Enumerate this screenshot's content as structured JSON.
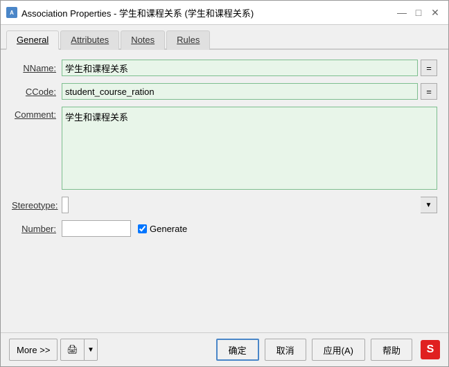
{
  "window": {
    "title": "Association Properties - 学生和课程关系 (学生和课程关系)",
    "icon_label": "AP"
  },
  "title_controls": {
    "minimize": "—",
    "maximize": "□",
    "close": "✕"
  },
  "tabs": [
    {
      "id": "general",
      "label": "General",
      "underline_char": "G",
      "active": true
    },
    {
      "id": "attributes",
      "label": "Attributes",
      "underline_char": "A",
      "active": false
    },
    {
      "id": "notes",
      "label": "Notes",
      "underline_char": "N",
      "active": false
    },
    {
      "id": "rules",
      "label": "Rules",
      "underline_char": "R",
      "active": false
    }
  ],
  "form": {
    "name_label": "Name:",
    "name_underline": "N",
    "name_value": "学生和课程关系",
    "code_label": "Code:",
    "code_underline": "C",
    "code_value": "student_course_ration",
    "comment_label": "Comment:",
    "comment_value": "学生和课程关系",
    "stereotype_label": "Stereotype:",
    "stereotype_underline": "S",
    "stereotype_value": "",
    "number_label": "Number:",
    "number_value": "",
    "generate_label": "Generate",
    "eq_btn": "="
  },
  "footer": {
    "more_label": "More >>",
    "print_icon": "🖨",
    "confirm_label": "确定",
    "cancel_label": "取消",
    "apply_label": "应用(A)",
    "help_label": "帮助",
    "s_badge": "S"
  }
}
